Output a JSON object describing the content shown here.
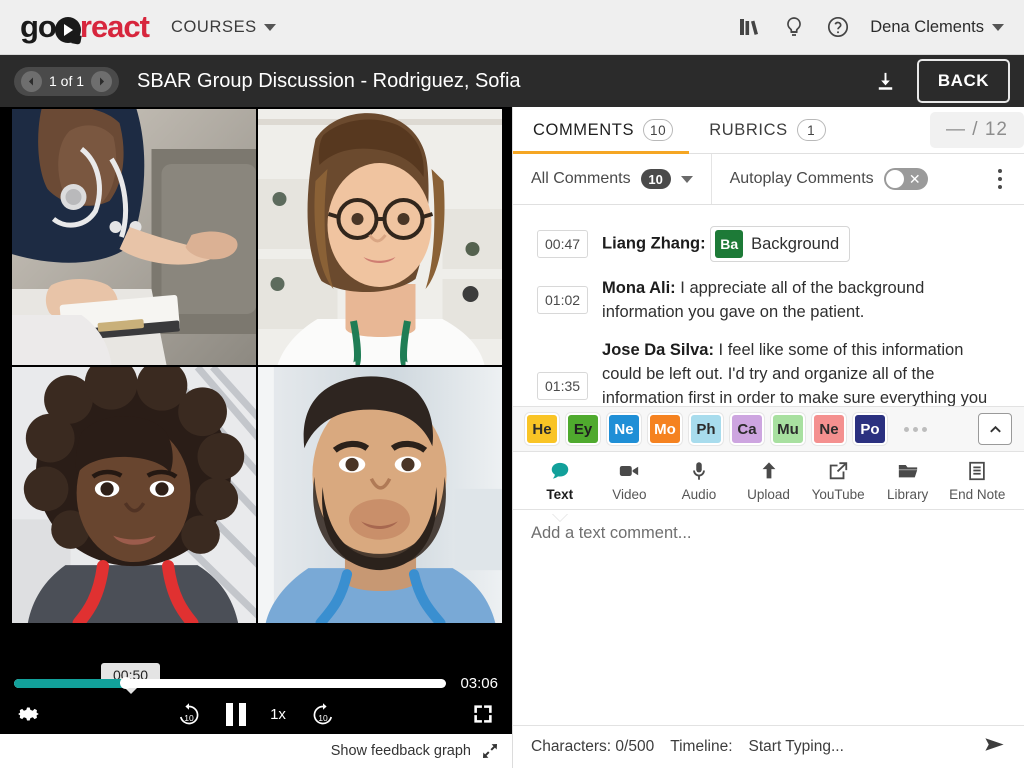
{
  "topnav": {
    "logo_go": "go",
    "logo_react": "react",
    "courses_label": "COURSES",
    "icons": [
      "library-books-icon",
      "lightbulb-icon",
      "help-circle-icon"
    ],
    "user_name": "Dena Clements"
  },
  "subheader": {
    "pager_text": "1 of 1",
    "title": "SBAR Group Discussion - Rodriguez, Sofia",
    "download_icon": "download-icon",
    "back_label": "BACK"
  },
  "video": {
    "participants": [
      {
        "name": "nurse-with-patient",
        "desc": "Nurse in navy scrubs holding patient hand"
      },
      {
        "name": "clinician-glasses",
        "desc": "Woman with glasses and white coat"
      },
      {
        "name": "nurse-curly-hair",
        "desc": "Woman with curly hair and red stethoscope"
      },
      {
        "name": "bearded-clinician",
        "desc": "Bearded man in blue scrubs"
      }
    ],
    "current_time": "00:50",
    "duration": "03:06",
    "progress_percent": 26,
    "speed": "1x",
    "skip_back": "10",
    "skip_forward": "10",
    "playback_state": "playing",
    "feedback_label": "Show feedback graph"
  },
  "panel": {
    "tabs": [
      {
        "label": "COMMENTS",
        "badge": "10",
        "active": true
      },
      {
        "label": "RUBRICS",
        "badge": "1",
        "active": false
      }
    ],
    "score": "— / 12",
    "filter_label": "All Comments",
    "filter_badge": "10",
    "autoplay_label": "Autoplay Comments",
    "autoplay_on": false
  },
  "comments": [
    {
      "time": "00:47",
      "author": "Liang Zhang:",
      "text": "",
      "tag": {
        "key": "Ba",
        "name": "Background",
        "color": "#1d7a37"
      }
    },
    {
      "time": "01:02",
      "author": "Mona Ali:",
      "text": " I appreciate all of the background information you gave on the patient."
    },
    {
      "time": "01:35",
      "author": "Jose Da Silva:",
      "text": " I feel like some of this information could be left out. I'd try and organize all of the information first in order to make sure everything you share is relevant."
    }
  ],
  "tags": [
    {
      "abbr": "He",
      "bg": "#f9c425",
      "fg": "#2c2c2c"
    },
    {
      "abbr": "Ey",
      "bg": "#4faa2e",
      "fg": "#1f1f1f"
    },
    {
      "abbr": "Ne",
      "bg": "#1f8fd6",
      "fg": "#ffffff"
    },
    {
      "abbr": "Mo",
      "bg": "#f58220",
      "fg": "#ffffff"
    },
    {
      "abbr": "Ph",
      "bg": "#a8dced",
      "fg": "#2c2c2c"
    },
    {
      "abbr": "Ca",
      "bg": "#cda5e0",
      "fg": "#2c2c2c"
    },
    {
      "abbr": "Mu",
      "bg": "#a8e0a0",
      "fg": "#2c2c2c"
    },
    {
      "abbr": "Ne",
      "bg": "#f4908f",
      "fg": "#2c2c2c"
    },
    {
      "abbr": "Po",
      "bg": "#2b3180",
      "fg": "#ffffff"
    }
  ],
  "composer": {
    "tabs": [
      {
        "label": "Text",
        "icon": "speech-bubble-icon",
        "active": true
      },
      {
        "label": "Video",
        "icon": "video-camera-icon",
        "active": false
      },
      {
        "label": "Audio",
        "icon": "microphone-icon",
        "active": false
      },
      {
        "label": "Upload",
        "icon": "upload-arrow-icon",
        "active": false
      },
      {
        "label": "YouTube",
        "icon": "external-link-icon",
        "active": false
      },
      {
        "label": "Library",
        "icon": "folder-icon",
        "active": false
      },
      {
        "label": "End Note",
        "icon": "document-icon",
        "active": false
      }
    ],
    "placeholder": "Add a text comment...",
    "characters_label": "Characters: 0/500",
    "timeline_label": "Timeline:",
    "timeline_value": "Start Typing...",
    "send_icon": "send-icon"
  },
  "colors": {
    "accent_teal": "#12a09a",
    "accent_orange": "#f5a623",
    "brand_red": "#d7263d",
    "dark_header": "#2b2b2b"
  }
}
